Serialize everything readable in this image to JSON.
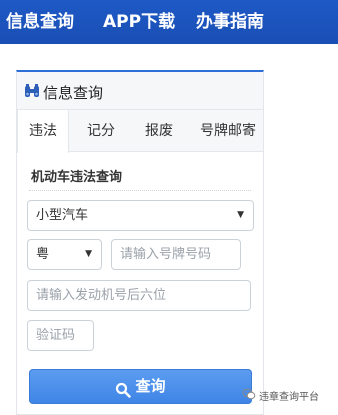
{
  "nav": {
    "items": [
      "信息查询",
      "APP下载",
      "办事指南"
    ]
  },
  "panel": {
    "title": "信息查询",
    "icon": "binoculars-icon"
  },
  "tabs": [
    {
      "label": "违法",
      "active": true
    },
    {
      "label": "记分",
      "active": false
    },
    {
      "label": "报废",
      "active": false
    },
    {
      "label": "号牌邮寄",
      "active": false
    }
  ],
  "form": {
    "section_title": "机动车违法查询",
    "car_type": {
      "value": "小型汽车"
    },
    "province": {
      "value": "粤"
    },
    "plate": {
      "placeholder": "请输入号牌号码"
    },
    "engine": {
      "placeholder": "请输入发动机号后六位"
    },
    "captcha": {
      "placeholder": "验证码"
    },
    "submit_label": "查询"
  },
  "watermark": {
    "text": "违章查询平台",
    "icon": "wechat-icon"
  },
  "colors": {
    "nav_bg": "#1e59c6",
    "accent": "#2d6fd6",
    "button_bg": "#4a8fea"
  }
}
